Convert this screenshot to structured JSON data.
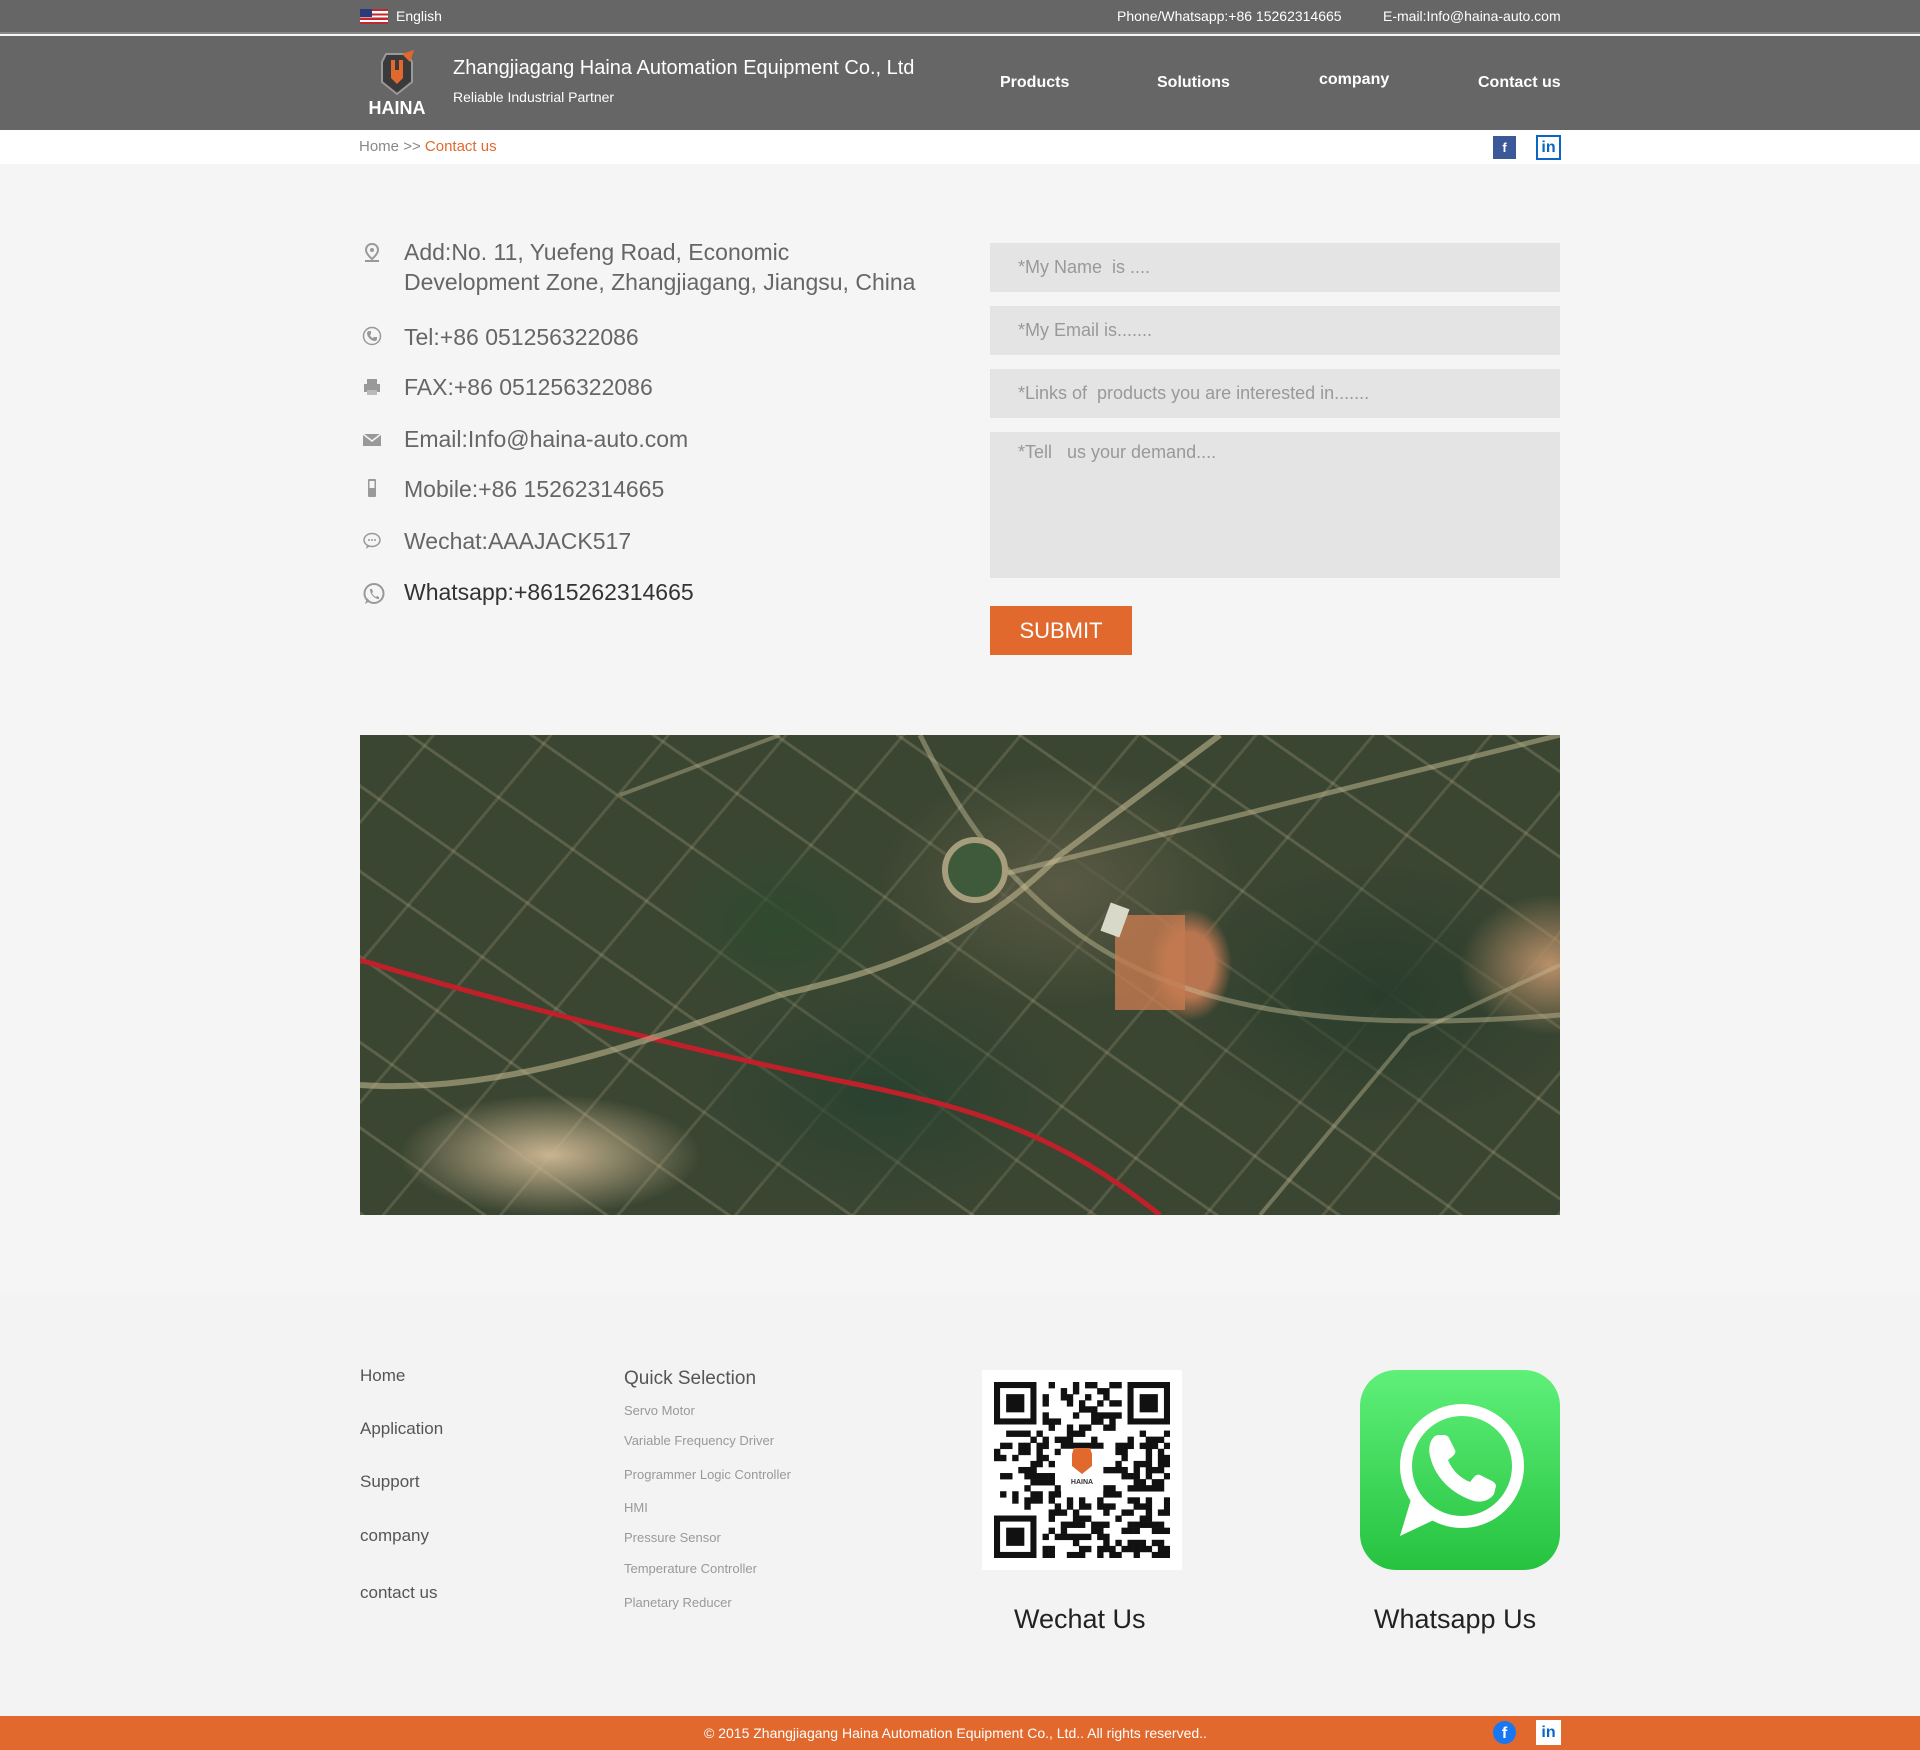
{
  "topbar": {
    "language": "English",
    "phone": "Phone/Whatsapp:+86 15262314665",
    "email": "E-mail:Info@haina-auto.com"
  },
  "header": {
    "logo_text": "HAINA",
    "company_name": "Zhangjiagang Haina Automation Equipment Co., Ltd",
    "tagline": "Reliable Industrial Partner",
    "nav": [
      "Products",
      "Solutions",
      "company",
      "Contact us"
    ]
  },
  "breadcrumb": {
    "home": "Home",
    "separator": ">>",
    "current": "Contact us"
  },
  "social": {
    "facebook": "f",
    "linkedin": "in"
  },
  "contact": {
    "address_line1": "Add:No. 11, Yuefeng Road, Economic",
    "address_line2": "Development Zone, Zhangjiagang, Jiangsu, China",
    "tel": "Tel:+86 051256322086",
    "fax": "FAX:+86 051256322086",
    "email": "Email:Info@haina-auto.com",
    "mobile": "Mobile:+86 15262314665",
    "wechat": "Wechat:AAAJACK517",
    "whatsapp": "Whatsapp:+8615262314665"
  },
  "form": {
    "name_placeholder": "*My Name  is ....",
    "email_placeholder": "*My Email is.......",
    "links_placeholder": "*Links of  products you are interested in.......",
    "demand_placeholder": "*Tell   us your demand....",
    "submit_label": "SUBMIT"
  },
  "footer": {
    "links": [
      "Home",
      "Application",
      "Support",
      "company",
      "contact us"
    ],
    "quick_selection_title": "Quick Selection",
    "quick_selection": [
      "Servo Motor",
      "Variable Frequency Driver",
      "Programmer Logic Controller",
      "HMI",
      "Pressure Sensor",
      "Temperature Controller",
      "Planetary Reducer"
    ],
    "wechat_label": "Wechat Us",
    "whatsapp_label": "Whatsapp Us",
    "qr_logo_text": "HAINA"
  },
  "copyright": "© 2015 Zhangjiagang Haina Automation Equipment Co., Ltd.. All rights reserved..",
  "colors": {
    "accent": "#e2692d",
    "header_bg": "#666666",
    "whatsapp_green": "#25c23f"
  }
}
